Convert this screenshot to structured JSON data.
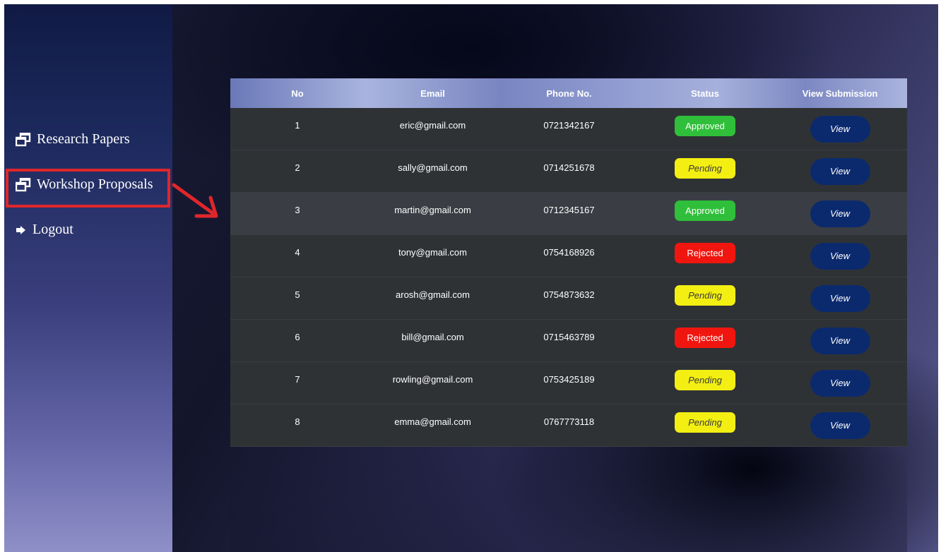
{
  "sidebar": {
    "items": [
      {
        "label": "Research Papers",
        "icon": "windows-icon"
      },
      {
        "label": "Workshop Proposals",
        "icon": "windows-icon"
      },
      {
        "label": "Logout",
        "icon": "logout-arrow-icon"
      }
    ]
  },
  "table": {
    "headers": [
      "No",
      "Email",
      "Phone No.",
      "Status",
      "View Submission"
    ],
    "rows": [
      {
        "no": "1",
        "email": "eric@gmail.com",
        "phone": "0721342167",
        "status": "Approved",
        "action": "View"
      },
      {
        "no": "2",
        "email": "sally@gmail.com",
        "phone": "0714251678",
        "status": "Pending",
        "action": "View"
      },
      {
        "no": "3",
        "email": "martin@gmail.com",
        "phone": "0712345167",
        "status": "Approved",
        "action": "View"
      },
      {
        "no": "4",
        "email": "tony@gmail.com",
        "phone": "0754168926",
        "status": "Rejected",
        "action": "View"
      },
      {
        "no": "5",
        "email": "arosh@gmail.com",
        "phone": "0754873632",
        "status": "Pending",
        "action": "View"
      },
      {
        "no": "6",
        "email": "bill@gmail.com",
        "phone": "0715463789",
        "status": "Rejected",
        "action": "View"
      },
      {
        "no": "7",
        "email": "rowling@gmail.com",
        "phone": "0753425189",
        "status": "Pending",
        "action": "View"
      },
      {
        "no": "8",
        "email": "emma@gmail.com",
        "phone": "0767773118",
        "status": "Pending",
        "action": "View"
      }
    ]
  },
  "colors": {
    "approved": "#2fbf3a",
    "pending": "#f3ef12",
    "rejected": "#f0160f",
    "view_button": "#0b2a6e",
    "highlight": "#e0262b"
  }
}
